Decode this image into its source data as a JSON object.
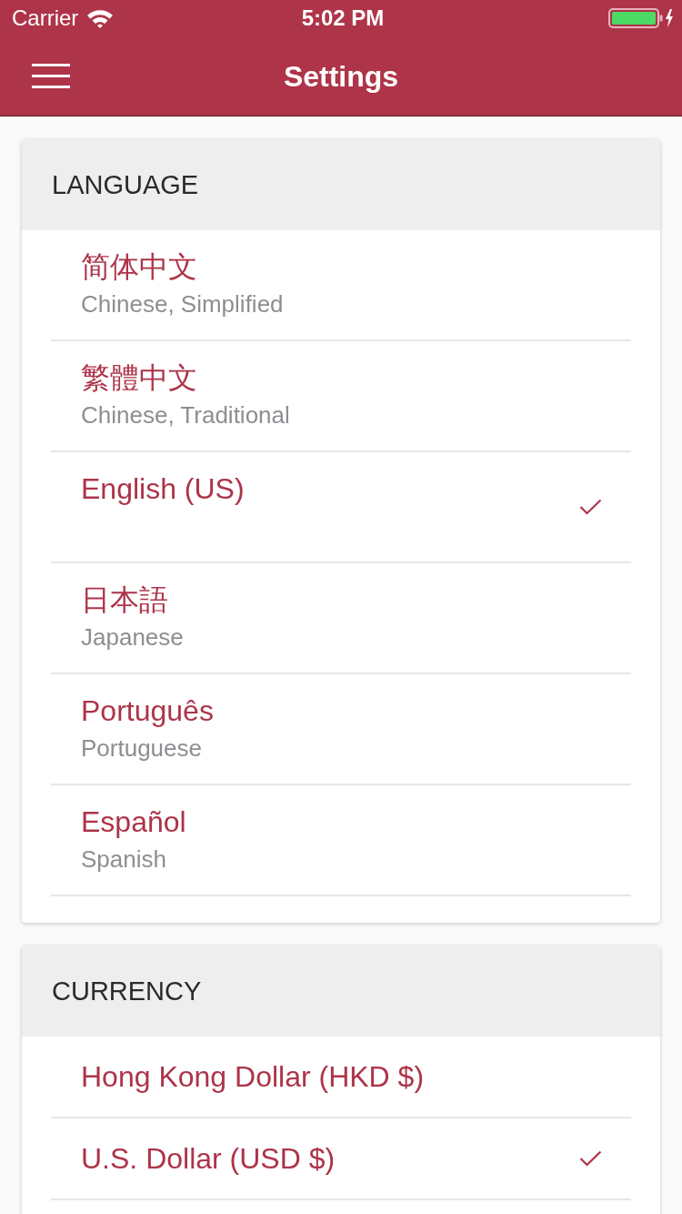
{
  "status_bar": {
    "carrier": "Carrier",
    "time": "5:02 PM"
  },
  "nav_bar": {
    "title": "Settings"
  },
  "sections": [
    {
      "title": "LANGUAGE",
      "items": [
        {
          "label": "简体中文",
          "sublabel": "Chinese, Simplified",
          "selected": false
        },
        {
          "label": "繁體中文",
          "sublabel": "Chinese, Traditional",
          "selected": false
        },
        {
          "label": "English (US)",
          "selected": true
        },
        {
          "label": "日本語",
          "sublabel": "Japanese",
          "selected": false
        },
        {
          "label": "Português",
          "sublabel": "Portuguese",
          "selected": false
        },
        {
          "label": "Español",
          "sublabel": "Spanish",
          "selected": false
        }
      ]
    },
    {
      "title": "CURRENCY",
      "items": [
        {
          "label": "Hong Kong Dollar (HKD $)",
          "selected": false
        },
        {
          "label": "U.S. Dollar (USD $)",
          "selected": true
        }
      ]
    }
  ]
}
